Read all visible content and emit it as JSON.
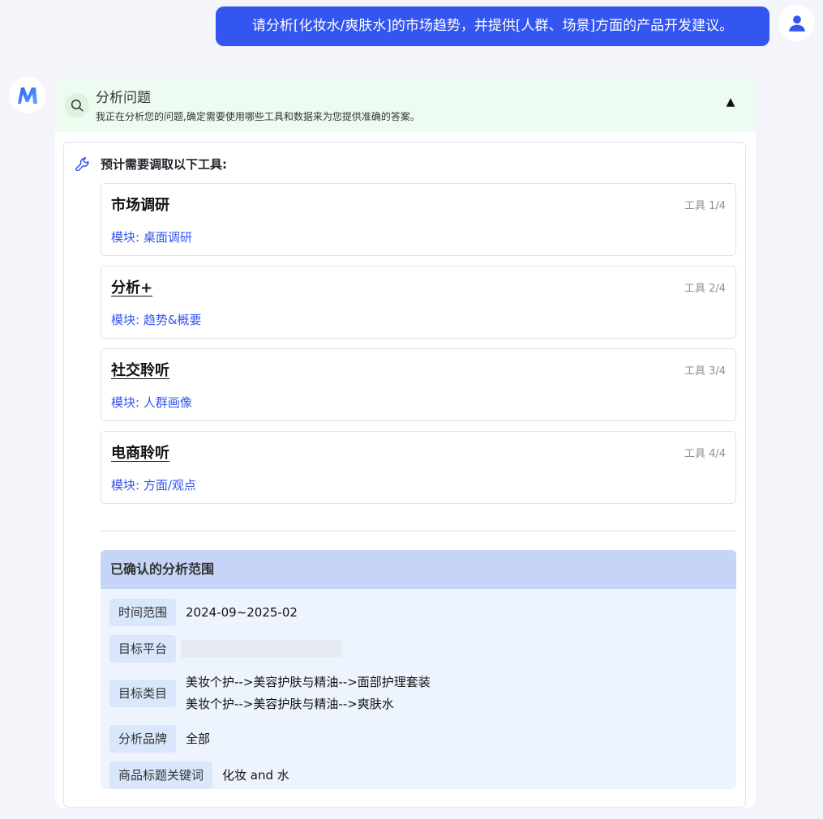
{
  "user_message": {
    "text": "请分析[化妆水/爽肤水]的市场趋势，并提供[人群、场景]方面的产品开发建议。"
  },
  "avatars": {
    "user_icon": "user-icon",
    "bot_logo_text": "M",
    "bot_logo_color": "#3a6cf4"
  },
  "analysis": {
    "title": "分析问题",
    "description": "我正在分析您的问题,确定需要使用哪些工具和数据来为您提供准确的答案。",
    "toggle": "▲",
    "tools_heading": "预计需要调取以下工具:",
    "tools": [
      {
        "name": "市场调研",
        "index": "工具 1/4",
        "module": "模块: 桌面调研"
      },
      {
        "name": "分析+",
        "index": "工具 2/4",
        "module": "模块: 趋势&概要"
      },
      {
        "name": "社交聆听",
        "index": "工具 3/4",
        "module": "模块: 人群画像"
      },
      {
        "name": "电商聆听",
        "index": "工具 4/4",
        "module": "模块: 方面/观点"
      }
    ],
    "scope": {
      "title": "已确认的分析范围",
      "time_label": "时间范围",
      "time_value": "2024-09~2025-02",
      "platform_label": "目标平台",
      "category_label": "目标类目",
      "category_values": [
        "美妆个护-->美容护肤与精油-->面部护理套装",
        "美妆个护-->美容护肤与精油-->爽肤水"
      ],
      "brand_label": "分析品牌",
      "brand_value": "全部",
      "keyword_label": "商品标题关键词",
      "keyword_value": "化妆 and 水"
    }
  },
  "colors": {
    "accent": "#3355f0",
    "header_bg": "#eefbf0",
    "scope_header_bg": "#c6d5f7",
    "scope_bg": "#eef4fe"
  }
}
